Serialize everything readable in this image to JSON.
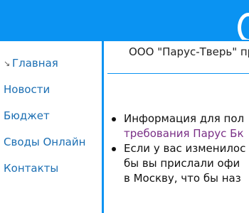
{
  "colors": {
    "brand_blue": "#0a93f2",
    "nav_link": "#1c6fb3",
    "visited_link": "#7a2f86"
  },
  "sidebar": {
    "items": [
      {
        "label": "Главная",
        "icon": "arrow-icon"
      },
      {
        "label": "Новости"
      },
      {
        "label": "Бюджет"
      },
      {
        "label": "Своды Онлайн"
      },
      {
        "label": "Контакты"
      }
    ]
  },
  "main": {
    "org_title": "ООО \"Парус-Тверь\" пр",
    "list": [
      {
        "text": "Информация для пол",
        "link": "требования Парус Бк"
      },
      {
        "lines": [
          "Если у вас изменилос",
          "бы вы прислали офи",
          "в Москву, что бы наз"
        ]
      }
    ]
  }
}
